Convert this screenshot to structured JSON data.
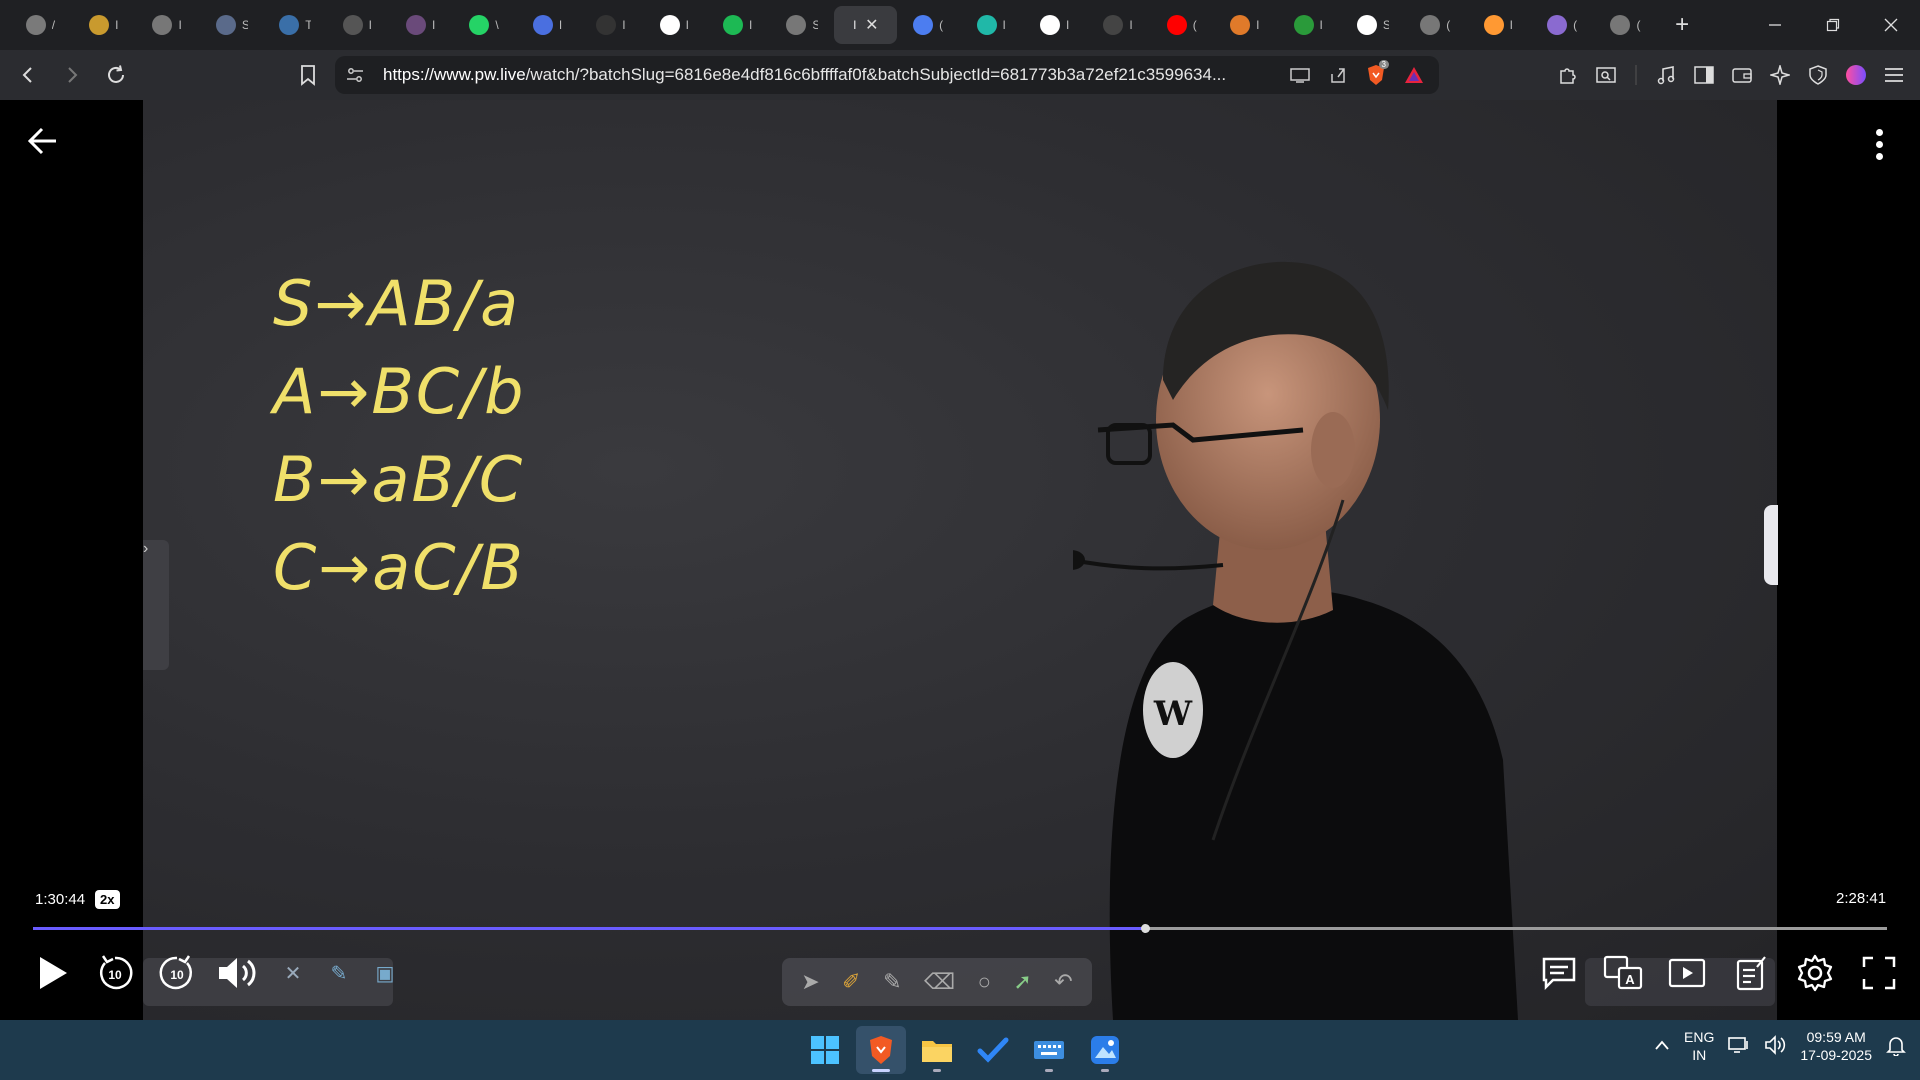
{
  "browser": {
    "tabs": [
      {
        "letter": "/",
        "icon": "chatgpt-icon",
        "color": "#7a7a7a"
      },
      {
        "letter": "I",
        "icon": "coin-icon",
        "color": "#c99a2e"
      },
      {
        "letter": "I",
        "icon": "globe-icon",
        "color": "#777"
      },
      {
        "letter": "S",
        "icon": "site-icon",
        "color": "#5a6a8a"
      },
      {
        "letter": "T",
        "icon": "wordpress-icon",
        "color": "#3a6fa8"
      },
      {
        "letter": "I",
        "icon": "box-icon",
        "color": "#555"
      },
      {
        "letter": "I",
        "icon": "avatar-icon",
        "color": "#6a4a7a"
      },
      {
        "letter": "\\",
        "icon": "whatsapp-icon",
        "color": "#25d366"
      },
      {
        "letter": "I",
        "icon": "bookmark-icon",
        "color": "#4a6fe0"
      },
      {
        "letter": "I",
        "icon": "arxiv-icon",
        "color": "#333"
      },
      {
        "letter": "I",
        "icon": "google-icon",
        "color": "#ffffff"
      },
      {
        "letter": "I",
        "icon": "spotify-icon",
        "color": "#1db954"
      },
      {
        "letter": "S",
        "icon": "globe-icon",
        "color": "#777"
      },
      {
        "letter": "I",
        "icon": "active-tab-icon",
        "color": "#3a3b3f",
        "active": true
      },
      {
        "letter": "(",
        "icon": "gemini-icon",
        "color": "#4c7df0"
      },
      {
        "letter": "I",
        "icon": "perplexity-icon",
        "color": "#20b8a8"
      },
      {
        "letter": "I",
        "icon": "google-icon",
        "color": "#ffffff"
      },
      {
        "letter": "I",
        "icon": "screen-icon",
        "color": "#444"
      },
      {
        "letter": "(",
        "icon": "youtube-icon",
        "color": "#ff0000"
      },
      {
        "letter": "I",
        "icon": "burger-icon",
        "color": "#e07a2a"
      },
      {
        "letter": "I",
        "icon": "leetcode-icon",
        "color": "#2a9a3a"
      },
      {
        "letter": "S",
        "icon": "wikipedia-icon",
        "color": "#ffffff"
      },
      {
        "letter": "(",
        "icon": "globe-icon",
        "color": "#777"
      },
      {
        "letter": "I",
        "icon": "india-flag-icon",
        "color": "#ff9933"
      },
      {
        "letter": "(",
        "icon": "circle-icon",
        "color": "#8a6ad0"
      },
      {
        "letter": "(",
        "icon": "globe-icon",
        "color": "#777"
      }
    ],
    "new_tab": "+",
    "url_host": "https://www.pw.live",
    "url_path": "/watch/?batchSlug=6816e8e4df816c6bffffaf0f&batchSubjectId=681773b3a72ef21c3599634...",
    "brave_badge": "3"
  },
  "video": {
    "board_lines": [
      "S→AB/a",
      "A→BC/b",
      "B→aB/C",
      "C→aC/B"
    ],
    "logo_text": "PW",
    "current_time": "1:30:44",
    "speed": "2x",
    "total_time": "2:28:41",
    "progress_fraction": 0.6
  },
  "taskbar": {
    "lang_top": "ENG",
    "lang_bottom": "IN",
    "time": "09:59 AM",
    "date": "17-09-2025"
  }
}
